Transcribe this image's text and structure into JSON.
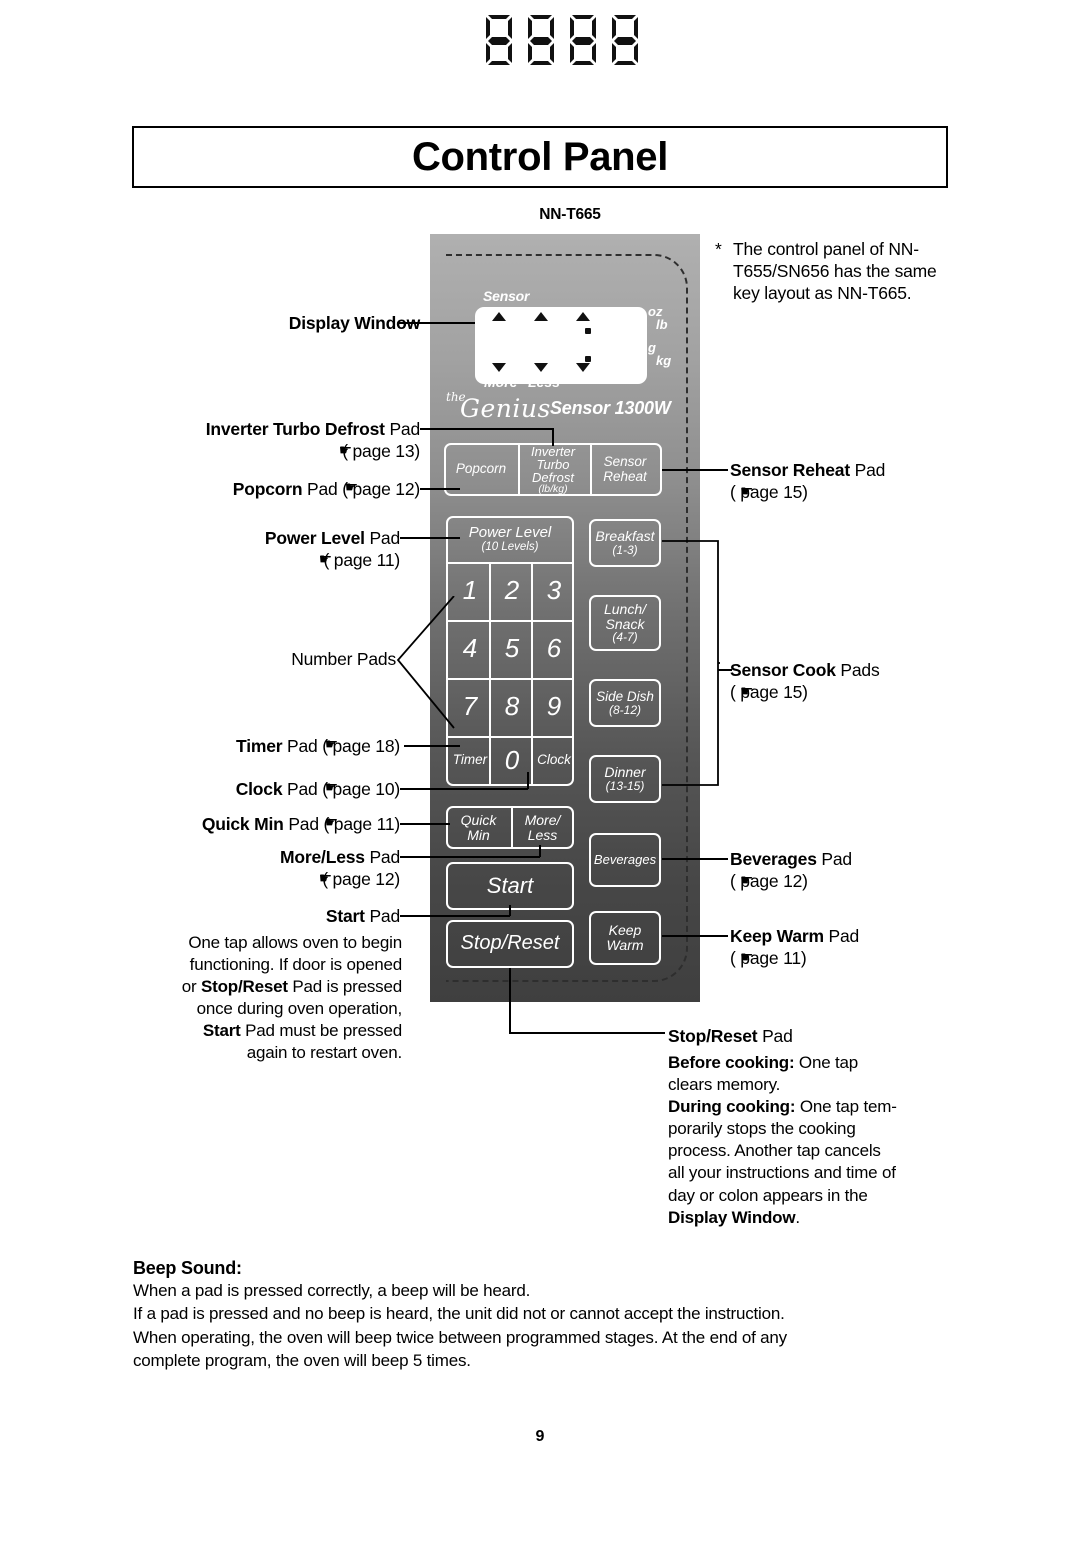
{
  "page": {
    "title": "Control Panel",
    "model_label": "NN-T665",
    "page_number": "9"
  },
  "footnote": {
    "marker": "*",
    "text": "The control panel of NN-T655/SN656 has the same key layout as NN-T665."
  },
  "display": {
    "digits": "88:88",
    "sensor_label": "Sensor",
    "more_label": "More",
    "less_label": "Less",
    "unit_oz": "oz",
    "unit_lb": "lb",
    "unit_g": "g",
    "unit_kg": "kg"
  },
  "brand": {
    "the": "the",
    "genius": "Genius",
    "sensor_watt": "Sensor 1300W"
  },
  "keys": {
    "popcorn": "Popcorn",
    "inverter_l1": "Inverter",
    "inverter_l2": "Turbo",
    "inverter_l3": "Defrost",
    "inverter_sub": "(lb/kg)",
    "sensor_reheat_l1": "Sensor",
    "sensor_reheat_l2": "Reheat",
    "power_level_l1": "Power Level",
    "power_level_sub": "(10 Levels)",
    "breakfast_l1": "Breakfast",
    "breakfast_sub": "(1-3)",
    "lunch_l1": "Lunch/",
    "lunch_l2": "Snack",
    "lunch_sub": "(4-7)",
    "side_dish_l1": "Side Dish",
    "side_dish_sub": "(8-12)",
    "dinner_l1": "Dinner",
    "dinner_sub": "(13-15)",
    "beverages": "Beverages",
    "keep_warm_l1": "Keep",
    "keep_warm_l2": "Warm",
    "timer": "Timer",
    "clock": "Clock",
    "quick_l1": "Quick",
    "quick_l2": "Min",
    "moreless_l1": "More/",
    "moreless_l2": "Less",
    "start": "Start",
    "stop_reset": "Stop/Reset",
    "numbers": [
      "1",
      "2",
      "3",
      "4",
      "5",
      "6",
      "7",
      "8",
      "9",
      "0"
    ]
  },
  "annotations": {
    "display_window": "Display Window",
    "inverter_name": "Inverter Turbo Defrost",
    "inverter_suffix": " Pad",
    "inverter_page": "( page 13)",
    "popcorn_name": "Popcorn",
    "popcorn_rest": " Pad ( page 12)",
    "power_level_name": "Power Level",
    "power_level_suffix": " Pad",
    "power_level_page": "( page 11)",
    "number_pads": "Number Pads",
    "timer_name": "Timer",
    "timer_rest": " Pad ( page 18)",
    "clock_name": "Clock",
    "clock_rest": " Pad ( page 10)",
    "quick_min_name": "Quick Min",
    "quick_min_rest": " Pad ( page 11)",
    "more_less_name": "More/Less",
    "more_less_suffix": " Pad",
    "more_less_page": "( page 12)",
    "start_name": "Start",
    "start_suffix": " Pad",
    "sensor_reheat_name": "Sensor Reheat",
    "sensor_reheat_suffix": " Pad",
    "sensor_reheat_page": "( page 15)",
    "sensor_cook_name": "Sensor Cook",
    "sensor_cook_suffix": " Pads",
    "sensor_cook_page": "( page 15)",
    "beverages_name": "Beverages",
    "beverages_suffix": " Pad",
    "beverages_page": "( page 12)",
    "keep_warm_name": "Keep Warm",
    "keep_warm_suffix": " Pad",
    "keep_warm_page": "( page 11)",
    "stop_reset_name": "Stop/Reset",
    "stop_reset_suffix": " Pad"
  },
  "start_description": {
    "line1": "One tap allows oven to begin",
    "line2": "functioning. If door is opened",
    "line3_pre": "or ",
    "line3_bold": "Stop/Reset",
    "line3_post": " Pad is pressed",
    "line4": "once during oven operation,",
    "line5_bold": "Start",
    "line5_post": " Pad must be pressed",
    "line6": "again to restart oven."
  },
  "stop_reset_description": {
    "before_label": "Before cooking:",
    "before_text": " One tap",
    "before_text2": "clears memory.",
    "during_label": "During cooking:",
    "during_text": " One tap tem-",
    "during_l2": "porarily stops the cooking",
    "during_l3": "process. Another tap cancels",
    "during_l4": "all your instructions and time of",
    "during_l5": "day or colon appears in the",
    "during_l6_bold": "Display Window",
    "during_l6_post": "."
  },
  "beep": {
    "title": "Beep Sound:",
    "lines": [
      "When a pad is pressed correctly, a beep will be heard.",
      "If a pad is pressed and no beep is heard, the unit did not or cannot accept the instruction.",
      "When operating, the oven will beep twice between programmed stages. At the end of any",
      "complete program, the oven will beep 5 times."
    ]
  }
}
